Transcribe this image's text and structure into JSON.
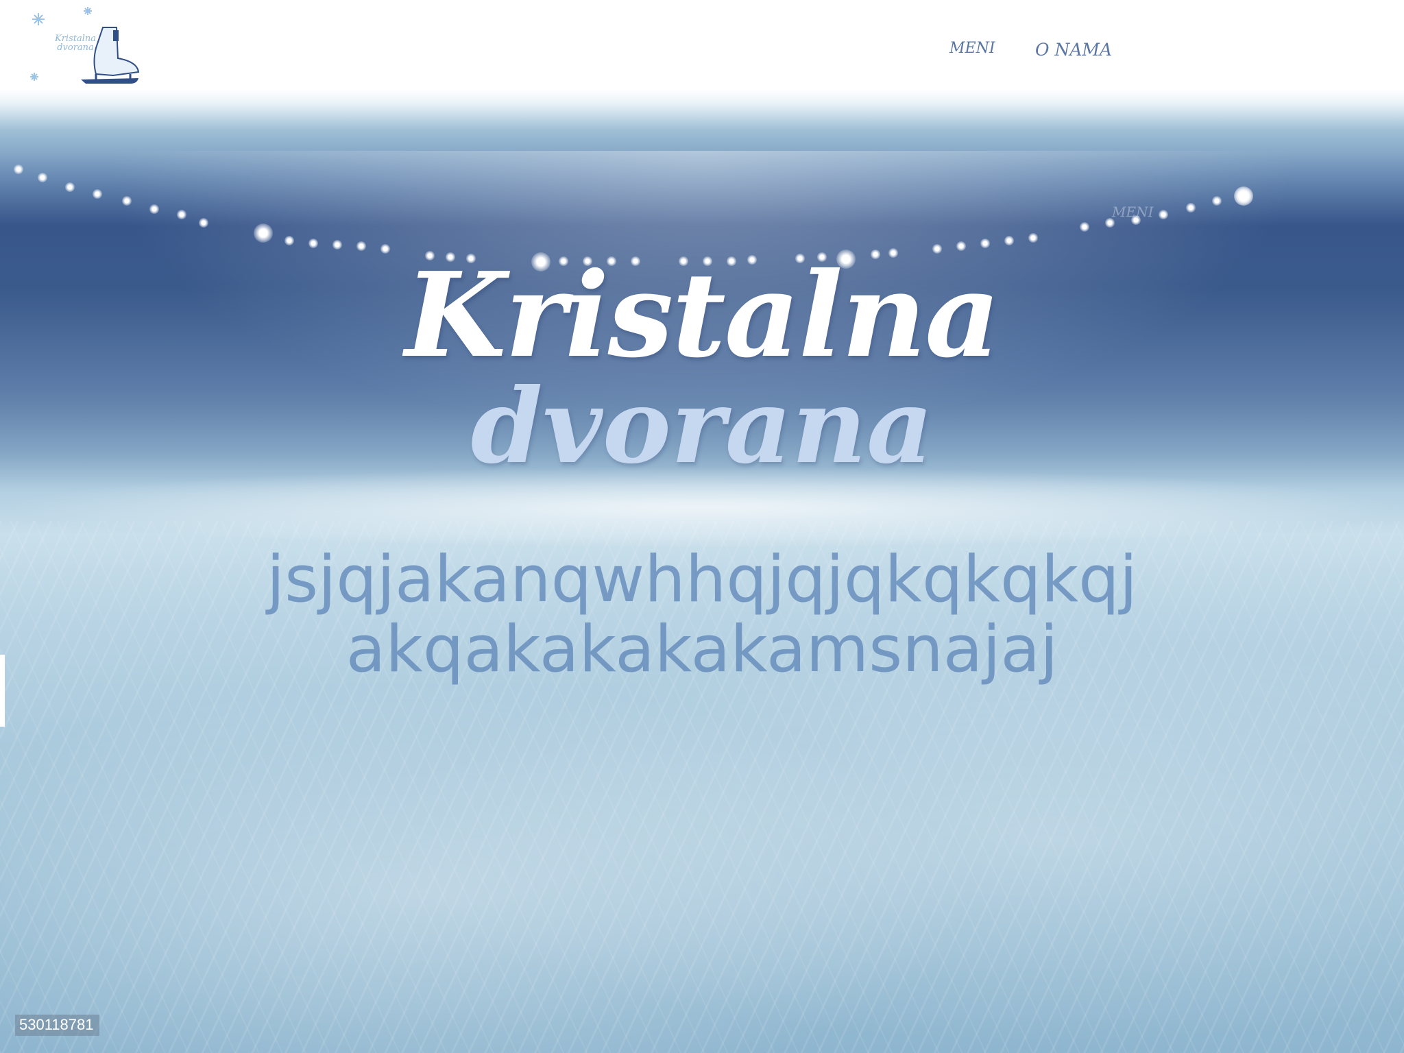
{
  "logo": {
    "line1": "Kristalna",
    "line2": "dvorana"
  },
  "nav": {
    "items": [
      {
        "label": "MENI"
      },
      {
        "label": "O NAMA"
      }
    ],
    "ghost_label": "MENI"
  },
  "hero": {
    "title_line1": "Kristalna",
    "title_line2": "dvorana",
    "subtitle_line1": "jsjqjakanqwhhqjqjqkqkqkqj",
    "subtitle_line2": "akqakakakakamsnajaj"
  },
  "image_id": "530118781",
  "colors": {
    "nav_text": "#5a77a3",
    "title_primary": "#ffffff",
    "title_secondary": "#c6d8f0",
    "subtitle": "#6088b8"
  }
}
